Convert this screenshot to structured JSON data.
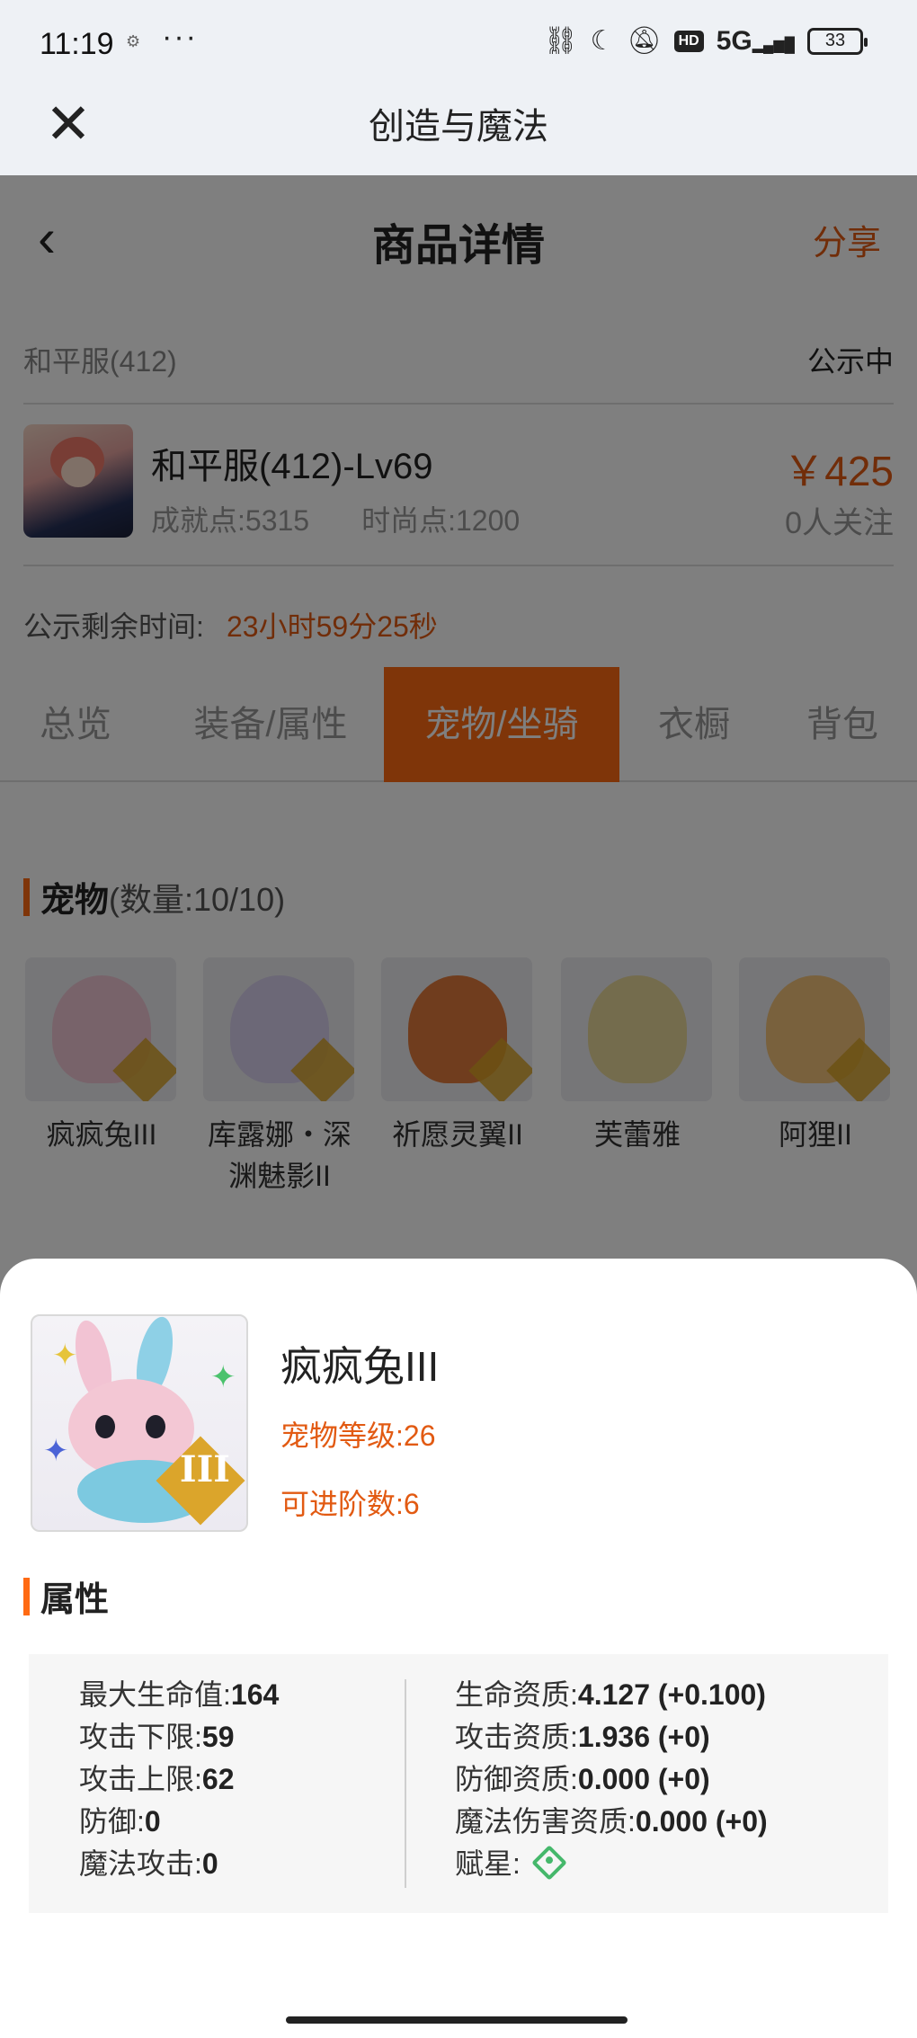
{
  "statusbar": {
    "time": "11:19",
    "dots": "···",
    "icons": [
      "link-icon",
      "moon-icon",
      "bell-mute-icon",
      "hd-icon",
      "signal-icon",
      "battery-icon"
    ],
    "hd": "HD",
    "signal": "5G",
    "battery": "33"
  },
  "app_header": {
    "close_icon": "✕",
    "title": "创造与魔法"
  },
  "nav": {
    "back_icon": "‹",
    "title": "商品详情",
    "share": "分享"
  },
  "listing": {
    "server": "和平服(412)",
    "status": "公示中",
    "character_name": "和平服(412)-Lv69",
    "achievement": "成就点:5315",
    "fashion": "时尚点:1200",
    "price": "￥425",
    "watchers": "0人关注",
    "countdown_label": "公示剩余时间:",
    "countdown_value": "23小时59分25秒"
  },
  "tabs": [
    {
      "label": "总览",
      "active": false
    },
    {
      "label": "装备/属性",
      "active": false
    },
    {
      "label": "宠物/坐骑",
      "active": true
    },
    {
      "label": "衣橱",
      "active": false
    },
    {
      "label": "背包",
      "active": false
    }
  ],
  "pets_section": {
    "title": "宠物",
    "count": "(数量:10/10)"
  },
  "pets": [
    {
      "name": "疯疯兔III",
      "color": "#f1c6d5"
    },
    {
      "name": "库露娜・深渊魅影II",
      "color": "#d8d0ee"
    },
    {
      "name": "祈愿灵翼II",
      "color": "#e07a3c"
    },
    {
      "name": "芙蕾雅",
      "color": "#e9d89a"
    },
    {
      "name": "阿狸II",
      "color": "#f2c27a"
    }
  ],
  "sheet": {
    "pet_name": "疯疯兔III",
    "level": "宠物等级:26",
    "advance": "可进阶数:6",
    "badge": "III",
    "attr_title": "属性",
    "left": [
      {
        "label": "最大生命值:",
        "value": "164"
      },
      {
        "label": "攻击下限:",
        "value": "59"
      },
      {
        "label": "攻击上限:",
        "value": "62"
      },
      {
        "label": "防御:",
        "value": "0"
      },
      {
        "label": "魔法攻击:",
        "value": "0"
      }
    ],
    "right": [
      {
        "label": "生命资质:",
        "value": "4.127 (+0.100)"
      },
      {
        "label": "攻击资质:",
        "value": "1.936 (+0)"
      },
      {
        "label": "防御资质:",
        "value": "0.000 (+0)"
      },
      {
        "label": "魔法伤害资质:",
        "value": "0.000 (+0)"
      },
      {
        "label": "赋星:",
        "value": ""
      }
    ],
    "star_icon": "star-gem-icon"
  },
  "colors": {
    "accent": "#ff6a13",
    "price": "#e25a12",
    "overlay": "rgba(0,0,0,0.5)"
  }
}
